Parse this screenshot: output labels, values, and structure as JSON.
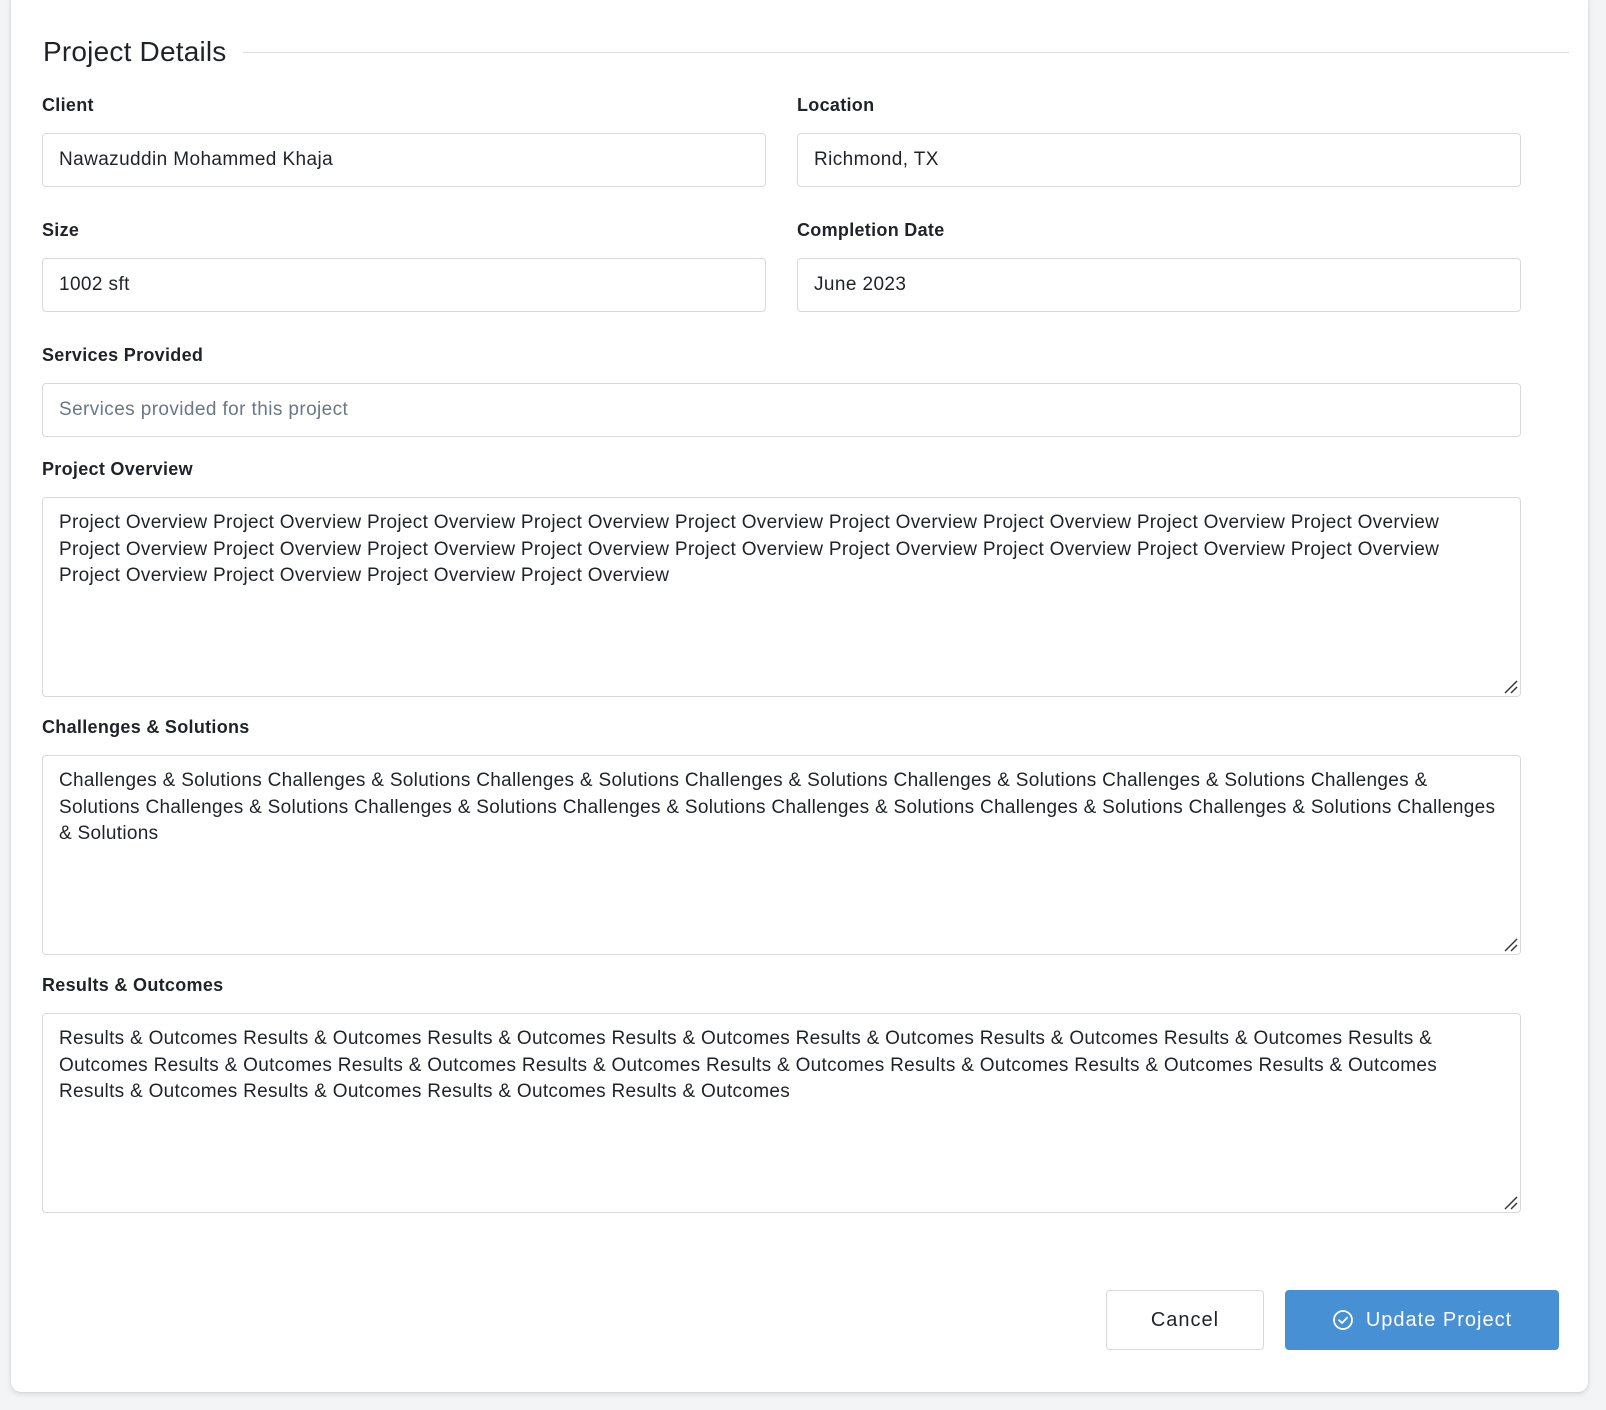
{
  "section": {
    "title": "Project Details"
  },
  "fields": {
    "client": {
      "label": "Client",
      "value": "Nawazuddin Mohammed Khaja"
    },
    "location": {
      "label": "Location",
      "value": "Richmond, TX"
    },
    "size": {
      "label": "Size",
      "value": "1002 sft"
    },
    "completion_date": {
      "label": "Completion Date",
      "value": "June 2023"
    },
    "services": {
      "label": "Services Provided",
      "value": "",
      "placeholder": "Services provided for this project"
    },
    "overview": {
      "label": "Project Overview",
      "value": "Project Overview Project Overview Project Overview Project Overview Project Overview Project Overview Project Overview Project Overview Project Overview Project Overview Project Overview Project Overview Project Overview Project Overview Project Overview Project Overview Project Overview Project Overview Project Overview Project Overview Project Overview Project Overview"
    },
    "challenges": {
      "label": "Challenges & Solutions",
      "value": "Challenges & Solutions Challenges & Solutions Challenges & Solutions Challenges & Solutions Challenges & Solutions Challenges & Solutions Challenges & Solutions Challenges & Solutions Challenges & Solutions Challenges & Solutions Challenges & Solutions Challenges & Solutions Challenges & Solutions Challenges & Solutions"
    },
    "results": {
      "label": "Results & Outcomes",
      "value": "Results & Outcomes Results & Outcomes Results & Outcomes Results & Outcomes Results & Outcomes Results & Outcomes Results & Outcomes Results & Outcomes Results & Outcomes Results & Outcomes Results & Outcomes Results & Outcomes Results & Outcomes Results & Outcomes Results & Outcomes Results & Outcomes Results & Outcomes Results & Outcomes Results & Outcomes"
    }
  },
  "actions": {
    "cancel_label": "Cancel",
    "submit_label": "Update Project"
  },
  "colors": {
    "primary": "#4690d3",
    "border": "#d6d9de",
    "text": "#1f2328",
    "placeholder": "#6b7785"
  },
  "icons": {
    "submit": "check-circle-icon",
    "resize": "resize-handle-icon"
  }
}
